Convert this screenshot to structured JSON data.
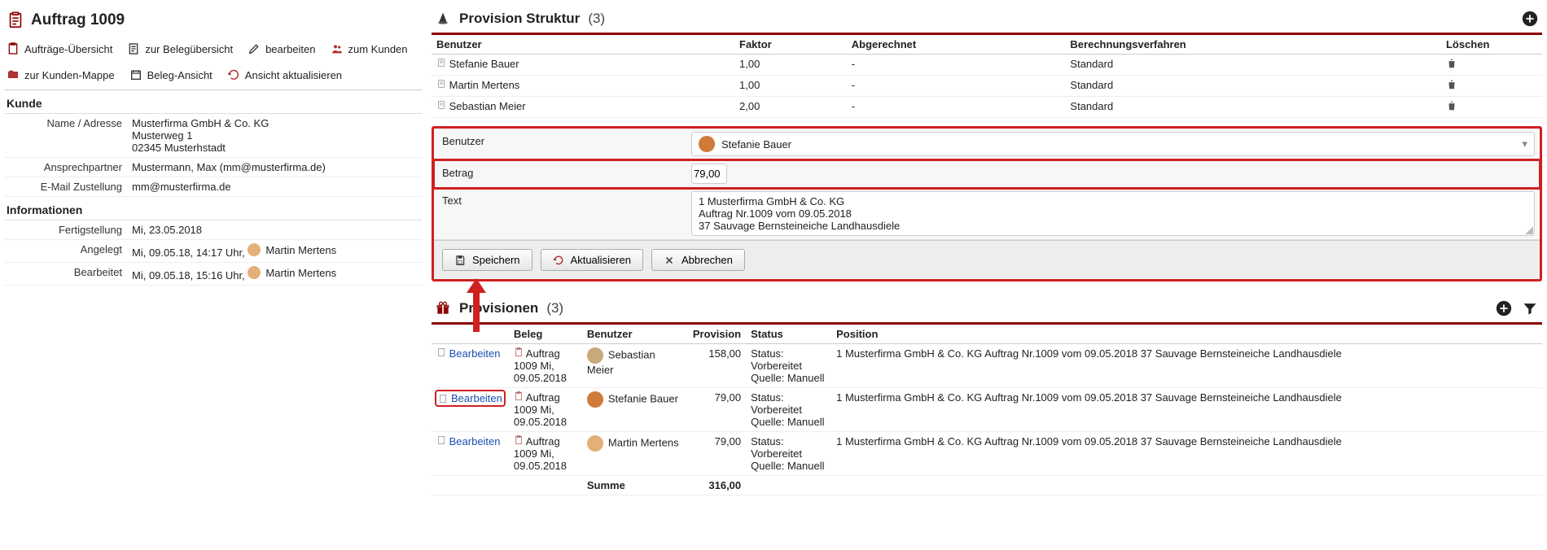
{
  "page_title": "Auftrag 1009",
  "toolbar": {
    "overview": "Aufträge-Übersicht",
    "beleg_overview": "zur Belegübersicht",
    "edit": "bearbeiten",
    "to_customer": "zum Kunden",
    "to_customer_folder": "zur Kunden-Mappe",
    "beleg_view": "Beleg-Ansicht",
    "refresh": "Ansicht aktualisieren"
  },
  "kunde": {
    "heading": "Kunde",
    "name_label": "Name / Adresse",
    "name_value": "Musterfirma GmbH & Co. KG\nMusterweg 1\n02345 Musterhstadt",
    "contact_label": "Ansprechpartner",
    "contact_value": "Mustermann, Max (mm@musterfirma.de)",
    "email_label": "E-Mail Zustellung",
    "email_value": "mm@musterfirma.de"
  },
  "info": {
    "heading": "Informationen",
    "fertig_label": "Fertigstellung",
    "fertig_value": "Mi, 23.05.2018",
    "angelegt_label": "Angelegt",
    "angelegt_value": "Mi, 09.05.18, 14:17 Uhr,",
    "angelegt_user": "Martin Mertens",
    "bearbeitet_label": "Bearbeitet",
    "bearbeitet_value": "Mi, 09.05.18, 15:16 Uhr,",
    "bearbeitet_user": "Martin Mertens"
  },
  "struktur": {
    "title": "Provision Struktur",
    "count": "(3)",
    "cols": {
      "benutzer": "Benutzer",
      "faktor": "Faktor",
      "abg": "Abgerechnet",
      "verfahren": "Berechnungsverfahren",
      "del": "Löschen"
    },
    "rows": [
      {
        "user": "Stefanie Bauer",
        "faktor": "1,00",
        "abg": "-",
        "verfahren": "Standard"
      },
      {
        "user": "Martin Mertens",
        "faktor": "1,00",
        "abg": "-",
        "verfahren": "Standard"
      },
      {
        "user": "Sebastian Meier",
        "faktor": "2,00",
        "abg": "-",
        "verfahren": "Standard"
      }
    ]
  },
  "form": {
    "benutzer_label": "Benutzer",
    "benutzer_value": "Stefanie Bauer",
    "betrag_label": "Betrag",
    "betrag_value": "79,00",
    "text_label": "Text",
    "text_value": "1 Musterfirma GmbH & Co. KG\nAuftrag Nr.1009 vom 09.05.2018\n37 Sauvage Bernsteineiche Landhausdiele",
    "save": "Speichern",
    "refresh": "Aktualisieren",
    "cancel": "Abbrechen"
  },
  "provisionen": {
    "title": "Provisionen",
    "count": "(3)",
    "cols": {
      "beleg": "Beleg",
      "benutzer": "Benutzer",
      "provision": "Provision",
      "status": "Status",
      "position": "Position"
    },
    "edit_label": "Bearbeiten",
    "rows": [
      {
        "beleg": "Auftrag 1009 Mi, 09.05.2018",
        "user": "Sebastian Meier",
        "prov": "158,00",
        "status": "Status: Vorbereitet\nQuelle: Manuell",
        "pos": "1 Musterfirma GmbH & Co. KG Auftrag Nr.1009 vom 09.05.2018 37 Sauvage Bernsteineiche Landhausdiele",
        "avatar": "#c9a97a",
        "highlight": false
      },
      {
        "beleg": "Auftrag 1009 Mi, 09.05.2018",
        "user": "Stefanie Bauer",
        "prov": "79,00",
        "status": "Status: Vorbereitet\nQuelle: Manuell",
        "pos": "1 Musterfirma GmbH & Co. KG Auftrag Nr.1009 vom 09.05.2018 37 Sauvage Bernsteineiche Landhausdiele",
        "avatar": "#d07a3a",
        "highlight": true
      },
      {
        "beleg": "Auftrag 1009 Mi, 09.05.2018",
        "user": "Martin Mertens",
        "prov": "79,00",
        "status": "Status: Vorbereitet\nQuelle: Manuell",
        "pos": "1 Musterfirma GmbH & Co. KG Auftrag Nr.1009 vom 09.05.2018 37 Sauvage Bernsteineiche Landhausdiele",
        "avatar": "#e3b07a",
        "highlight": false
      }
    ],
    "sum_label": "Summe",
    "sum_value": "316,00"
  }
}
